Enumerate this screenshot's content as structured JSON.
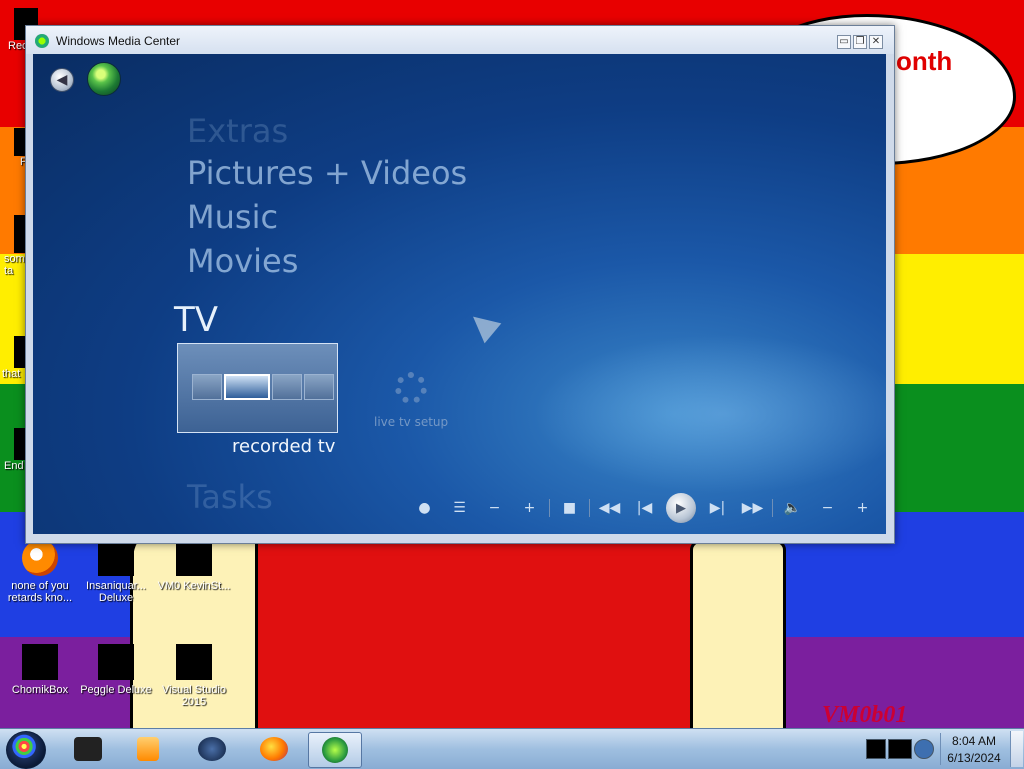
{
  "desktop": {
    "bubble_text": "onth",
    "watermark": "VM0b01",
    "edge_icons": [
      {
        "label": "Rec"
      },
      {
        "label": "F"
      },
      {
        "label": "som ta"
      },
      {
        "label": "that"
      },
      {
        "label": "End"
      }
    ],
    "icons": [
      {
        "label": "none of you retards kno..."
      },
      {
        "label": "Insaniquar... Deluxe"
      },
      {
        "label": "VM0 KevinSt..."
      },
      {
        "label": "ChomikBox"
      },
      {
        "label": "Peggle Deluxe"
      },
      {
        "label": "Visual Studio 2015"
      }
    ]
  },
  "window": {
    "title": "Windows Media Center",
    "controls": {
      "minimize": "▭",
      "restore": "❐",
      "close": "✕"
    },
    "menu": {
      "extras": "Extras",
      "pictures": "Pictures + Videos",
      "music": "Music",
      "movies": "Movies",
      "tv": "TV",
      "tasks": "Tasks"
    },
    "tiles": {
      "recorded": "recorded tv",
      "live_setup": "live tv setup"
    },
    "transport": {
      "record": "●",
      "guide": "☰",
      "ch_down": "−",
      "ch_up": "+",
      "stop": "■",
      "rewind": "◀◀",
      "prev": "|◀",
      "play": "▶",
      "next": "▶|",
      "ffwd": "▶▶",
      "mute": "🔈",
      "vol_down": "−",
      "vol_up": "+"
    }
  },
  "taskbar": {
    "clock_time": "8:04 AM",
    "clock_date": "6/13/2024"
  }
}
